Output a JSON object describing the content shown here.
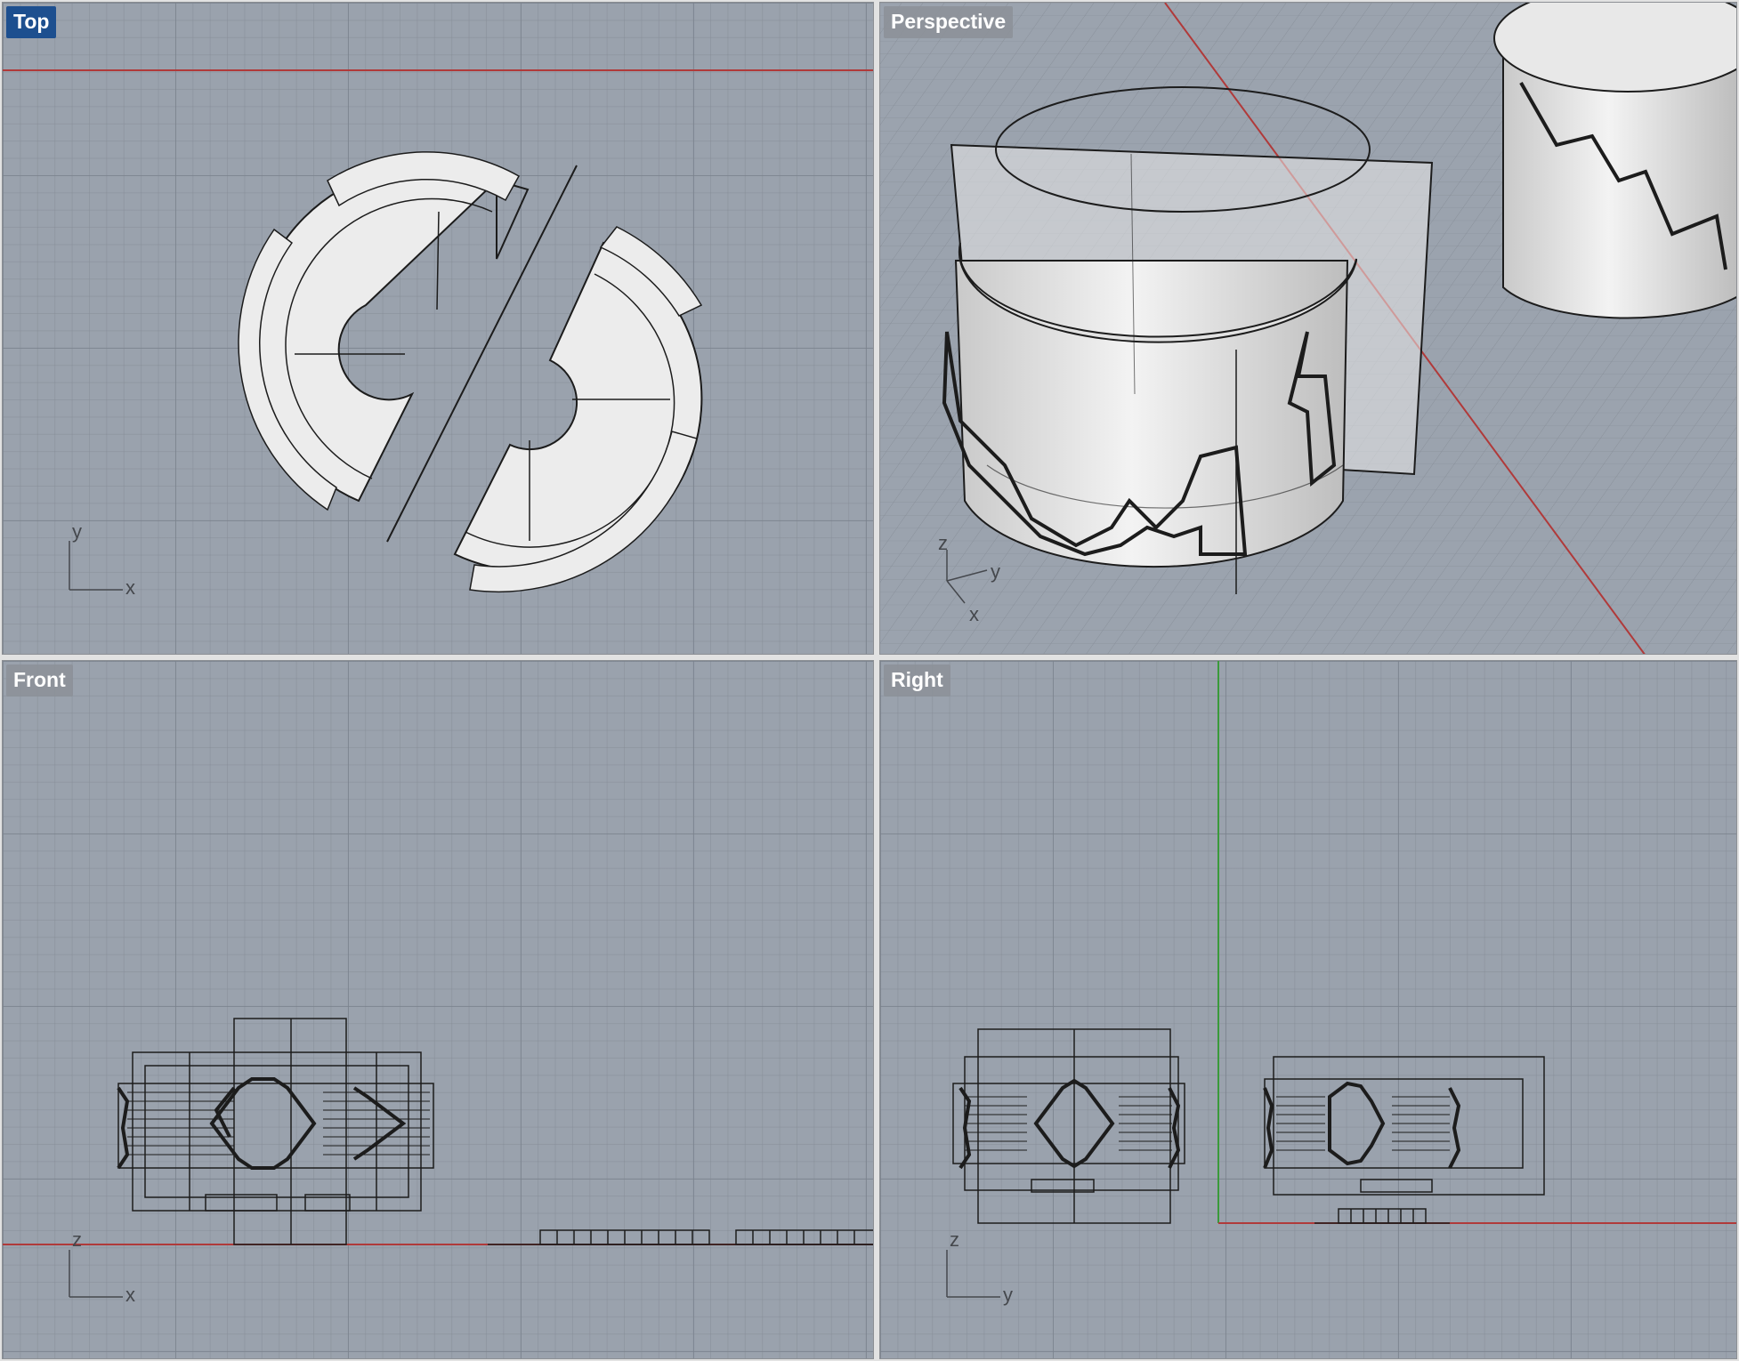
{
  "viewports": {
    "top": {
      "label": "Top",
      "active": true,
      "axes": {
        "horizontal": "x",
        "vertical": "y"
      }
    },
    "perspective": {
      "label": "Perspective",
      "active": false,
      "axes": {
        "vertical": "z",
        "depth": "y",
        "horizontal": "x"
      }
    },
    "front": {
      "label": "Front",
      "active": false,
      "axes": {
        "horizontal": "x",
        "vertical": "z"
      }
    },
    "right": {
      "label": "Right",
      "active": false,
      "axes": {
        "horizontal": "y",
        "vertical": "z"
      }
    }
  },
  "colors": {
    "viewport_bg": "#9aa2ad",
    "grid_major": "#7a828d",
    "grid_minor": "#848b95",
    "x_axis": "#b03a3a",
    "y_axis": "#3a9a3a",
    "active_label": "#1d4f8f",
    "object_fill": "#ececec",
    "object_edge": "#1c1c1c"
  }
}
